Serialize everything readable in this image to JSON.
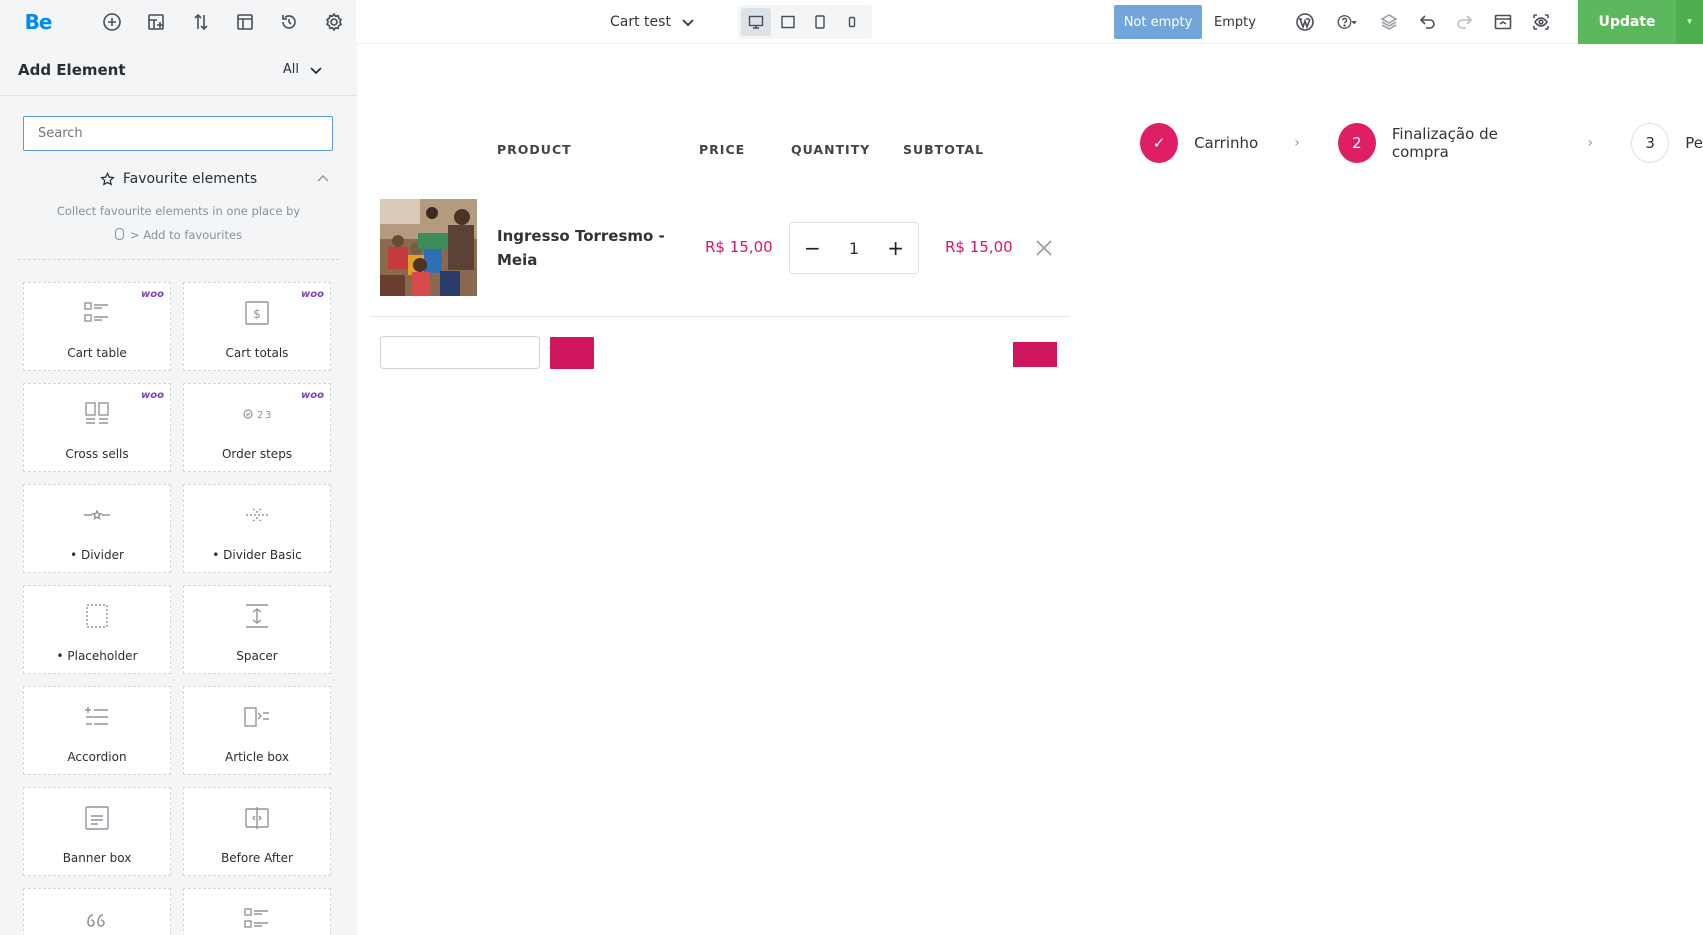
{
  "topbar": {
    "logo": "Be",
    "page_name": "Cart test",
    "btn_not_empty": "Not empty",
    "btn_empty": "Empty",
    "btn_update": "Update",
    "update_caret": "▾"
  },
  "sidebar": {
    "title": "Add Element",
    "filter": "All",
    "search_placeholder": "Search",
    "fav_title": "Favourite elements",
    "fav_desc_line1": "Collect favourite elements in one place by",
    "fav_desc_line2": "> Add to favourites",
    "woo_badge": "woo",
    "elements": [
      {
        "label": "Cart table",
        "icon": "cart-table-icon",
        "woo": true
      },
      {
        "label": "Cart totals",
        "icon": "cart-totals-icon",
        "woo": true
      },
      {
        "label": "Cross sells",
        "icon": "cross-sells-icon",
        "woo": true
      },
      {
        "label": "Order steps",
        "icon": "order-steps-icon",
        "woo": true
      },
      {
        "label": "• Divider",
        "icon": "divider-icon",
        "woo": false
      },
      {
        "label": "• Divider Basic",
        "icon": "divider-basic-icon",
        "woo": false
      },
      {
        "label": "• Placeholder",
        "icon": "placeholder-icon",
        "woo": false
      },
      {
        "label": "Spacer",
        "icon": "spacer-icon",
        "woo": false
      },
      {
        "label": "Accordion",
        "icon": "accordion-icon",
        "woo": false
      },
      {
        "label": "Article box",
        "icon": "article-box-icon",
        "woo": false
      },
      {
        "label": "Banner box",
        "icon": "banner-box-icon",
        "woo": false
      },
      {
        "label": "Before After",
        "icon": "before-after-icon",
        "woo": false
      },
      {
        "label": "",
        "icon": "quote-icon",
        "woo": false
      },
      {
        "label": "",
        "icon": "list-icon",
        "woo": false
      }
    ],
    "collapse_glyph": "‹"
  },
  "cart": {
    "headers": {
      "product": "PRODUCT",
      "price": "PRICE",
      "quantity": "QUANTITY",
      "subtotal": "SUBTOTAL"
    },
    "item": {
      "name": "Ingresso Torresmo - Meia",
      "price": "R$ 15,00",
      "quantity": "1",
      "subtotal": "R$ 15,00",
      "minus": "−",
      "plus": "+"
    }
  },
  "steps": [
    {
      "marker": "✓",
      "label": "Carrinho"
    },
    {
      "marker": "2",
      "label": "Finalização de compra"
    },
    {
      "marker": "3",
      "label": "Pe"
    }
  ],
  "step_separator": "›",
  "colors": {
    "accent": "#df1f65",
    "update_green": "#5cb85c",
    "not_empty_blue": "#72a5da",
    "logo_blue": "#0089f7"
  }
}
